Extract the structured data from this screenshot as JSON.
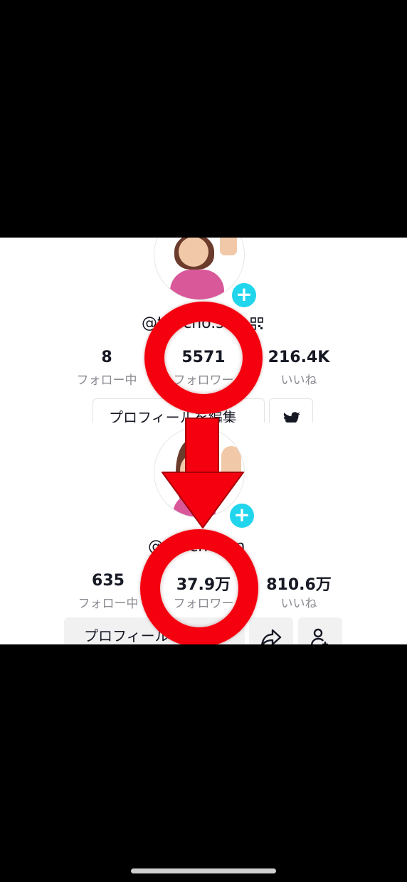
{
  "top_panel": {
    "handle": "@tencho.s",
    "stats": [
      {
        "value": "8",
        "label": "フォロー中"
      },
      {
        "value": "5571",
        "label": "フォロワー"
      },
      {
        "value": "216.4K",
        "label": "いいね"
      }
    ],
    "edit_button_label": "プロフィールを編集"
  },
  "bottom_panel": {
    "handle": "@tenchosan",
    "stats": [
      {
        "value": "635",
        "label": "フォロー中"
      },
      {
        "value": "37.9万",
        "label": "フォロワー"
      },
      {
        "value": "810.6万",
        "label": "いいね"
      }
    ],
    "edit_button_label": "プロフィールを編集"
  },
  "colors": {
    "highlight_red": "#f4000f",
    "plus_badge": "#20d5ec",
    "twitter_blue": "#1da1f2"
  },
  "icons": [
    "plus-icon",
    "qr-code-icon",
    "twitter-icon",
    "share-icon",
    "add-friend-icon",
    "down-arrow-icon"
  ]
}
